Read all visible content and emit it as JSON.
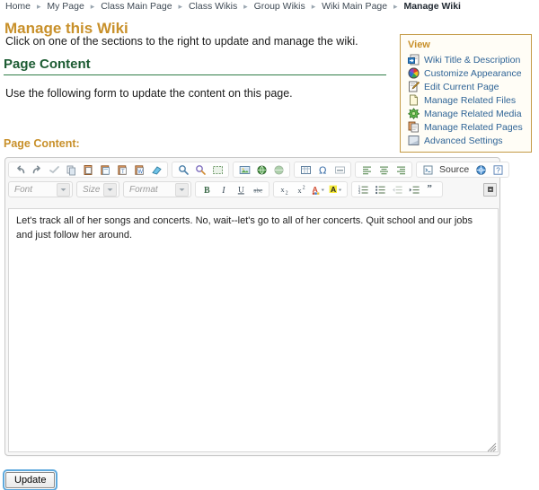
{
  "breadcrumb": {
    "separator": "▸",
    "items": [
      {
        "label": "Home",
        "current": false
      },
      {
        "label": "My Page",
        "current": false
      },
      {
        "label": "Class Main Page",
        "current": false
      },
      {
        "label": "Class Wikis",
        "current": false
      },
      {
        "label": "Group Wikis",
        "current": false
      },
      {
        "label": "Wiki Main Page",
        "current": false
      },
      {
        "label": "Manage Wiki",
        "current": true
      }
    ]
  },
  "page": {
    "title": "Manage this Wiki",
    "intro": "Click on one of the sections to the right to update and manage the wiki.",
    "section_heading": "Page Content",
    "section_description": "Use the following form to update the content on this page.",
    "field_label": "Page Content:"
  },
  "view_panel": {
    "title": "View",
    "items": [
      {
        "label": "Wiki Title & Description",
        "icon": "page-arrow-icon"
      },
      {
        "label": "Customize Appearance",
        "icon": "color-wheel-icon"
      },
      {
        "label": "Edit Current Page",
        "icon": "pencil-page-icon"
      },
      {
        "label": "Manage Related Files",
        "icon": "blank-page-icon"
      },
      {
        "label": "Manage Related Media",
        "icon": "media-burst-icon"
      },
      {
        "label": "Manage Related Pages",
        "icon": "stacked-pages-icon"
      },
      {
        "label": "Advanced Settings",
        "icon": "settings-square-icon"
      }
    ]
  },
  "editor": {
    "content": "Let's track all of her songs and concerts.  No, wait--let's go to all of her concerts.  Quit school and our jobs and just follow her around.",
    "toolbar_row1": [
      {
        "group": 1,
        "name": "undo-icon"
      },
      {
        "group": 1,
        "name": "redo-icon"
      },
      {
        "group": 1,
        "name": "spellcheck-icon"
      },
      {
        "group": 1,
        "name": "cut-icon"
      },
      {
        "group": 1,
        "name": "copy-icon"
      },
      {
        "group": 1,
        "name": "paste-icon"
      },
      {
        "group": 1,
        "name": "paste-text-icon"
      },
      {
        "group": 1,
        "name": "paste-word-icon"
      },
      {
        "group": 1,
        "name": "remove-format-icon"
      },
      {
        "group": 2,
        "name": "find-icon"
      },
      {
        "group": 2,
        "name": "replace-icon"
      },
      {
        "group": 2,
        "name": "select-all-icon"
      },
      {
        "group": 3,
        "name": "image-icon"
      },
      {
        "group": 3,
        "name": "link-icon"
      },
      {
        "group": 3,
        "name": "unlink-icon"
      },
      {
        "group": 4,
        "name": "table-icon"
      },
      {
        "group": 4,
        "name": "special-char-icon"
      },
      {
        "group": 4,
        "name": "horizontal-rule-icon"
      },
      {
        "group": 5,
        "name": "align-left-icon"
      },
      {
        "group": 5,
        "name": "align-center-icon"
      },
      {
        "group": 5,
        "name": "align-right-icon"
      },
      {
        "group": 6,
        "name": "source-icon"
      },
      {
        "group": 6,
        "name": "maximize-icon"
      },
      {
        "group": 6,
        "name": "help-icon"
      }
    ],
    "source_label": "Source",
    "combos": [
      {
        "name": "font-select",
        "placeholder": "Font"
      },
      {
        "name": "size-select",
        "placeholder": "Size"
      },
      {
        "name": "format-select",
        "placeholder": "Format"
      }
    ],
    "toolbar_row2": [
      {
        "group": 1,
        "name": "bold-icon",
        "glyph": "B"
      },
      {
        "group": 1,
        "name": "italic-icon",
        "glyph": "I"
      },
      {
        "group": 1,
        "name": "underline-icon",
        "glyph": "U"
      },
      {
        "group": 1,
        "name": "strikethrough-icon",
        "glyph": "abc"
      },
      {
        "group": 2,
        "name": "subscript-icon",
        "glyph": "x₂"
      },
      {
        "group": 2,
        "name": "superscript-icon",
        "glyph": "x²"
      },
      {
        "group": 2,
        "name": "text-color-icon",
        "glyph": "A"
      },
      {
        "group": 2,
        "name": "highlight-color-icon",
        "glyph": "A"
      },
      {
        "group": 3,
        "name": "numbered-list-icon"
      },
      {
        "group": 3,
        "name": "bulleted-list-icon"
      },
      {
        "group": 3,
        "name": "outdent-icon"
      },
      {
        "group": 3,
        "name": "indent-icon"
      },
      {
        "group": 3,
        "name": "blockquote-icon",
        "glyph": "”"
      }
    ]
  },
  "form": {
    "update_label": "Update"
  },
  "colors": {
    "title_gold": "#c8902a",
    "heading_green": "#1d5c33",
    "rule_green": "#2f7d47",
    "panel_border": "#c49a45",
    "link_blue": "#2f6496",
    "focus_blue": "#5ea9dd"
  }
}
